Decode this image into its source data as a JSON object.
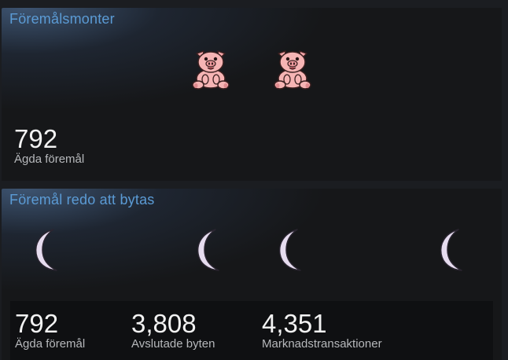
{
  "showcase_items": {
    "title": "Föremålsmonter",
    "icons": [
      "pig-sticker-icon",
      "pig-sticker-icon"
    ],
    "stat": {
      "value": "792",
      "label": "Ägda föremål"
    }
  },
  "showcase_trade": {
    "title": "Föremål redo att bytas",
    "icons": [
      "crescent-moon-icon",
      "crescent-moon-icon",
      "crescent-moon-icon",
      "crescent-moon-icon"
    ],
    "stats": [
      {
        "value": "792",
        "label": "Ägda föremål"
      },
      {
        "value": "3,808",
        "label": "Avslutade byten"
      },
      {
        "value": "4,351",
        "label": "Marknadstransaktioner"
      }
    ]
  },
  "colors": {
    "background": "#1b1d21",
    "title": "#5b9bd5",
    "value": "#f2f2f2",
    "label": "#b6b8bb",
    "moon": "#e6dcef",
    "pig": "#f4a9a8"
  }
}
